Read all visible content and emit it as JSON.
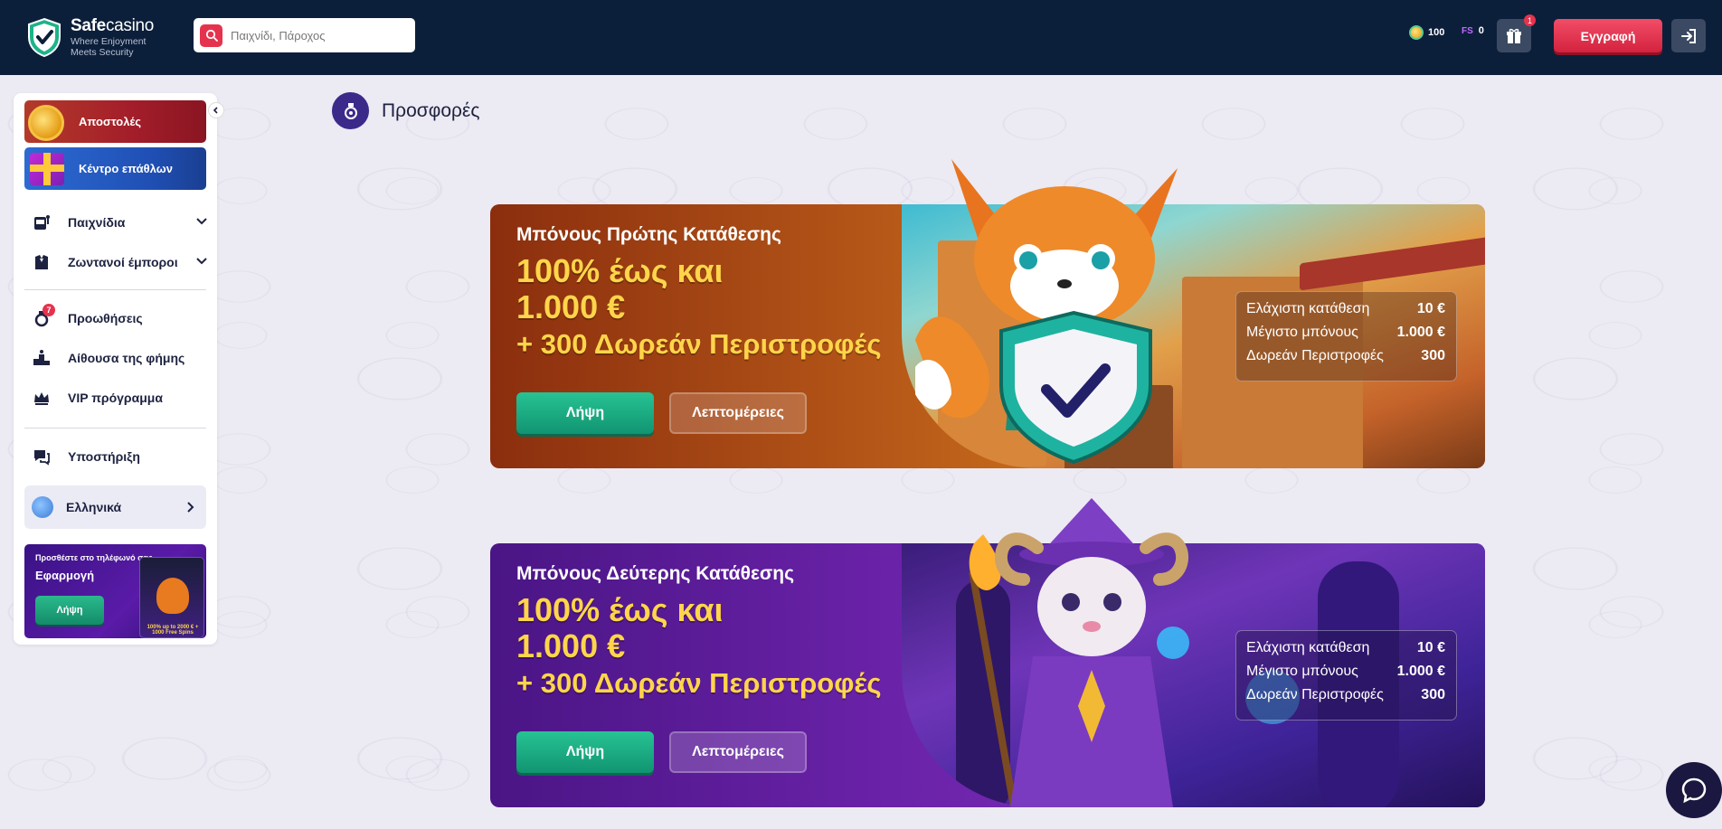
{
  "header": {
    "logo_name_bold": "Safe",
    "logo_name_light": "casino",
    "logo_tagline": "Where Enjoyment Meets Security",
    "search_placeholder": "Παιχνίδι, Πάροχος",
    "coins": "100",
    "free_spins_label": "FS",
    "free_spins": "0",
    "gift_count": "1",
    "register_label": "Εγγραφή"
  },
  "sidebar": {
    "missions_label": "Αποστολές",
    "rewards_label": "Κέντρο επάθλων",
    "items": [
      {
        "label": "Παιχνίδια",
        "icon": "slot-machine-icon"
      },
      {
        "label": "Ζωντανοί έμποροι",
        "icon": "dealer-icon"
      },
      {
        "label": "Προωθήσεις",
        "icon": "promotions-icon",
        "badge": "7"
      },
      {
        "label": "Αίθουσα της φήμης",
        "icon": "podium-icon"
      },
      {
        "label": "VIP πρόγραμμα",
        "icon": "crown-icon"
      },
      {
        "label": "Υποστήριξη",
        "icon": "support-icon"
      }
    ],
    "language": "Ελληνικά",
    "app_promo": {
      "line1": "Προσθέστε στο τηλέφωνό σας",
      "line2": "Εφαρμογή",
      "button": "Λήψη",
      "phone_text": "100% up to 2000 € + 1000 Free Spins"
    }
  },
  "main": {
    "title": "Προσφορές",
    "offers": [
      {
        "subtitle": "Μπόνους Πρώτης Κατάθεσης",
        "headline_1": "100% έως και",
        "headline_2": "1.000 €",
        "free_spins": "+ 300 Δωρεάν Περιστροφές",
        "get_label": "Λήψη",
        "details_label": "Λεπτομέρειες",
        "info": [
          {
            "label": "Ελάχιστη κατάθεση",
            "value": "10 €"
          },
          {
            "label": "Μέγιστο μπόνους",
            "value": "1.000 €"
          },
          {
            "label": "Δωρεάν Περιστροφές",
            "value": "300"
          }
        ]
      },
      {
        "subtitle": "Μπόνους Δεύτερης Κατάθεσης",
        "headline_1": "100% έως και",
        "headline_2": "1.000 €",
        "free_spins": "+ 300 Δωρεάν Περιστροφές",
        "get_label": "Λήψη",
        "details_label": "Λεπτομέρειες",
        "info": [
          {
            "label": "Ελάχιστη κατάθεση",
            "value": "10 €"
          },
          {
            "label": "Μέγιστο μπόνους",
            "value": "1.000 €"
          },
          {
            "label": "Δωρεάν Περιστροφές",
            "value": "300"
          }
        ]
      }
    ]
  },
  "colors": {
    "header_bg": "#0c1f3a",
    "accent_red": "#e5334d",
    "accent_green": "#27c394",
    "headline_yellow": "#ffd54a"
  }
}
